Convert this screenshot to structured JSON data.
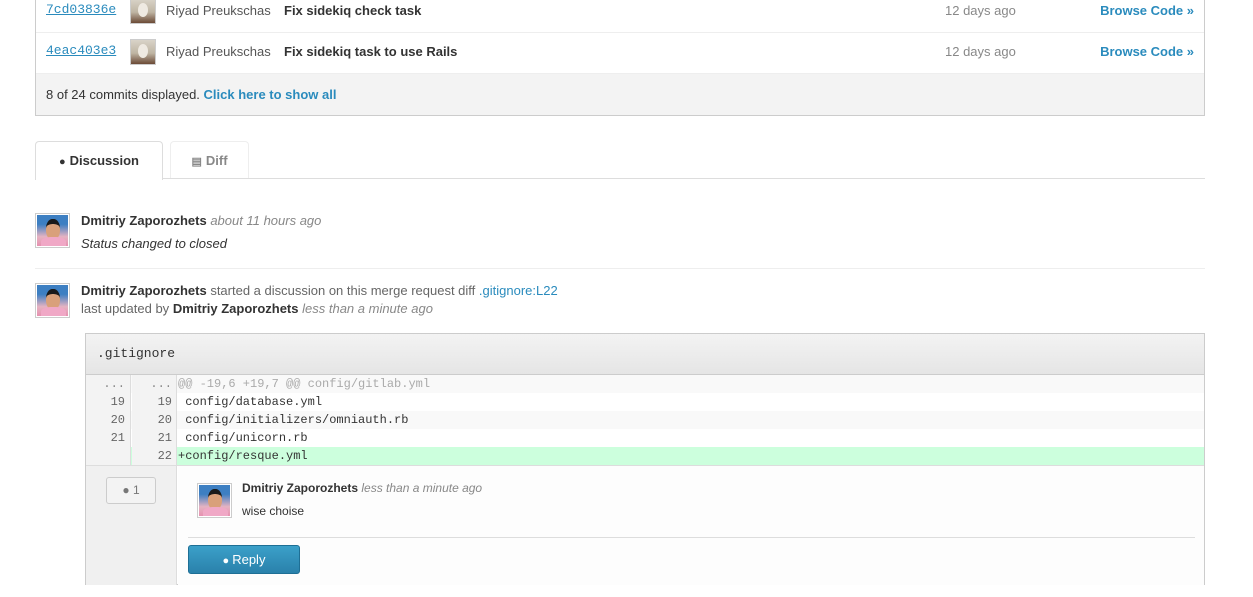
{
  "commits": {
    "rows": [
      {
        "sha": "7cd03836e",
        "author": "Riyad Preukschas",
        "title": "Fix sidekiq check task",
        "time": "12 days ago",
        "browse": "Browse Code »"
      },
      {
        "sha": "4eac403e3",
        "author": "Riyad Preukschas",
        "title": "Fix sidekiq task to use Rails",
        "time": "12 days ago",
        "browse": "Browse Code »"
      }
    ],
    "footer_text": "8 of 24 commits displayed.",
    "show_all_label": "Click here to show all"
  },
  "tabs": [
    {
      "label": "Discussion",
      "icon": "comment-icon",
      "glyph": "💬",
      "active": true
    },
    {
      "label": "Diff",
      "icon": "list-icon",
      "glyph": "▤",
      "active": false
    }
  ],
  "notes": [
    {
      "author": "Dmitriy Zaporozhets",
      "time": "about 11 hours ago",
      "body": "Status changed to closed"
    },
    {
      "author": "Dmitriy Zaporozhets",
      "action": "started a discussion on this merge request diff",
      "file_link": ".gitignore:L22",
      "updated_prefix": "last updated by",
      "updated_by": "Dmitriy Zaporozhets",
      "updated_time": "less than a minute ago"
    }
  ],
  "diff": {
    "filename": ".gitignore",
    "lines": [
      {
        "old": "...",
        "new": "...",
        "code": "@@ -19,6 +19,7 @@ config/gitlab.yml",
        "type": "meta"
      },
      {
        "old": "19",
        "new": "19",
        "code": " config/database.yml",
        "type": "even"
      },
      {
        "old": "20",
        "new": "20",
        "code": " config/initializers/omniauth.rb",
        "type": "odd"
      },
      {
        "old": "21",
        "new": "21",
        "code": " config/unicorn.rb",
        "type": "even"
      },
      {
        "old": "",
        "new": "22",
        "code": "+config/resque.yml",
        "type": "added"
      }
    ],
    "discussion": {
      "count": "1",
      "author": "Dmitriy Zaporozhets",
      "time": "less than a minute ago",
      "body": "wise choise",
      "reply_label": "Reply"
    }
  },
  "colors": {
    "link": "#2a8bbd",
    "added_line": "#ccffdd",
    "reply_button": "#2a81ab"
  }
}
